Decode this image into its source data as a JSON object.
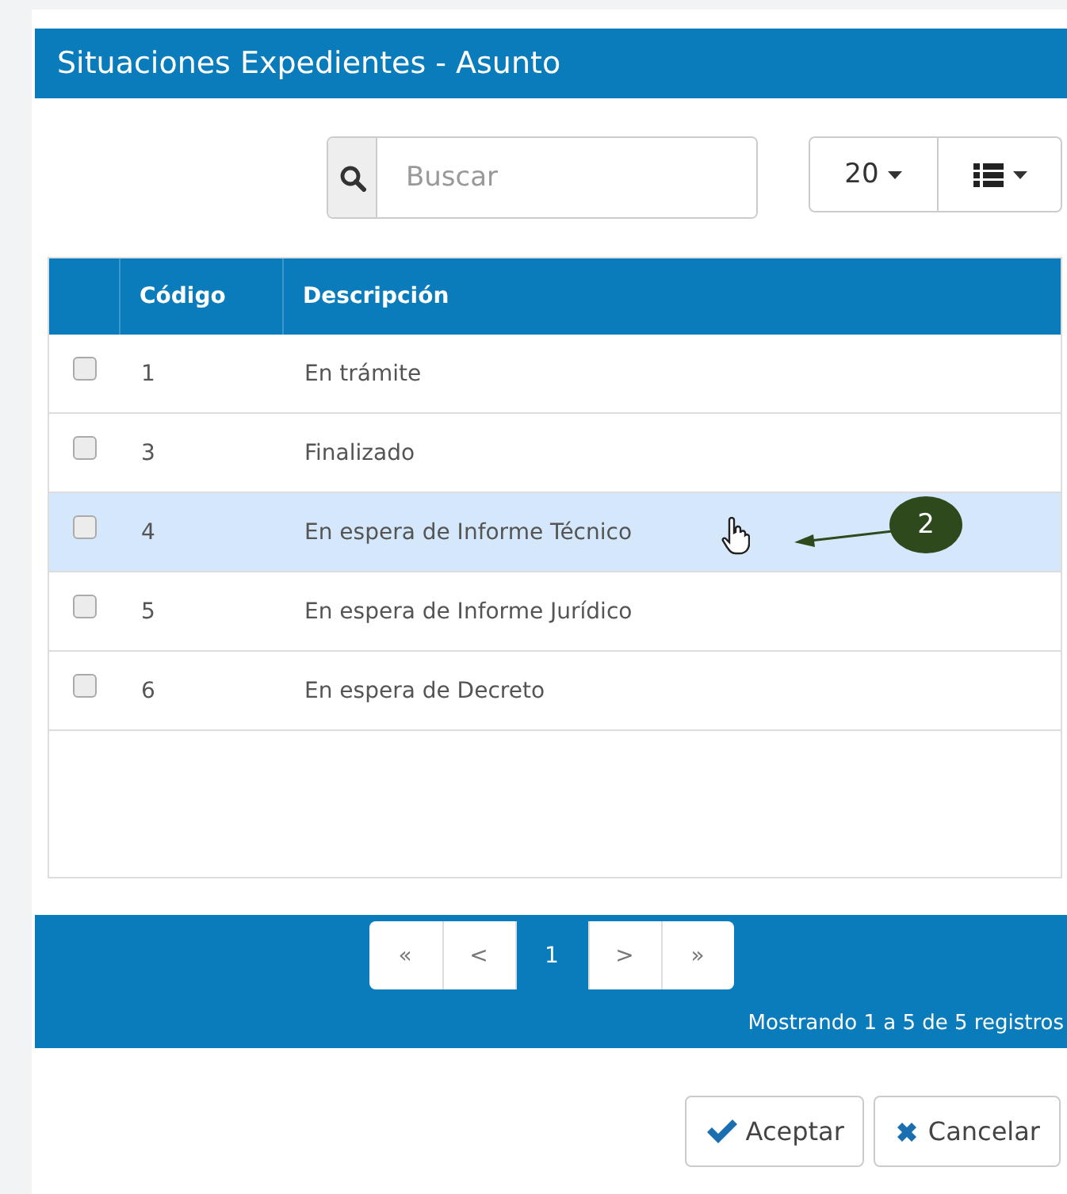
{
  "title": "Situaciones Expedientes - Asunto",
  "search": {
    "placeholder": "Buscar"
  },
  "page_size": "20",
  "table": {
    "columns": [
      "Código",
      "Descripción"
    ],
    "rows": [
      {
        "code": "1",
        "description": "En trámite",
        "checked": false,
        "highlighted": false
      },
      {
        "code": "3",
        "description": "Finalizado",
        "checked": false,
        "highlighted": false
      },
      {
        "code": "4",
        "description": "En espera de Informe Técnico",
        "checked": false,
        "highlighted": true
      },
      {
        "code": "5",
        "description": "En espera de Informe Jurídico",
        "checked": false,
        "highlighted": false
      },
      {
        "code": "6",
        "description": "En espera de Decreto",
        "checked": false,
        "highlighted": false
      }
    ]
  },
  "callout": {
    "number": "2"
  },
  "pager": [
    {
      "label": "«",
      "selected": false
    },
    {
      "label": "<",
      "selected": false
    },
    {
      "label": "1",
      "selected": true
    },
    {
      "label": ">",
      "selected": false
    },
    {
      "label": "»",
      "selected": false
    }
  ],
  "summary": "Mostrando 1 a 5 de 5 registros",
  "buttons": [
    {
      "label": "Aceptar",
      "kind": "accept"
    },
    {
      "label": "Cancelar",
      "kind": "cancel"
    }
  ]
}
